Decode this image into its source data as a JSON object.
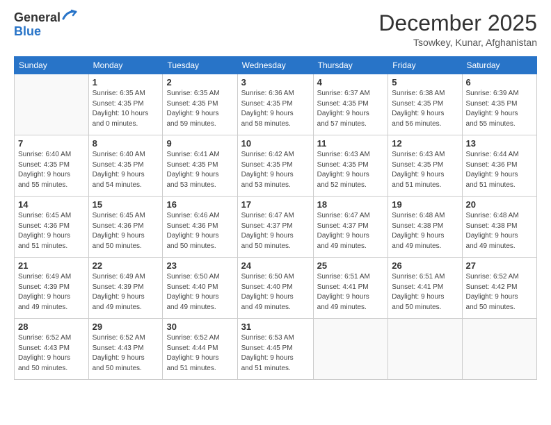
{
  "header": {
    "logo_line1": "General",
    "logo_line2": "Blue",
    "month": "December 2025",
    "location": "Tsowkey, Kunar, Afghanistan"
  },
  "weekdays": [
    "Sunday",
    "Monday",
    "Tuesday",
    "Wednesday",
    "Thursday",
    "Friday",
    "Saturday"
  ],
  "weeks": [
    [
      {
        "day": "",
        "info": ""
      },
      {
        "day": "1",
        "info": "Sunrise: 6:35 AM\nSunset: 4:35 PM\nDaylight: 10 hours\nand 0 minutes."
      },
      {
        "day": "2",
        "info": "Sunrise: 6:35 AM\nSunset: 4:35 PM\nDaylight: 9 hours\nand 59 minutes."
      },
      {
        "day": "3",
        "info": "Sunrise: 6:36 AM\nSunset: 4:35 PM\nDaylight: 9 hours\nand 58 minutes."
      },
      {
        "day": "4",
        "info": "Sunrise: 6:37 AM\nSunset: 4:35 PM\nDaylight: 9 hours\nand 57 minutes."
      },
      {
        "day": "5",
        "info": "Sunrise: 6:38 AM\nSunset: 4:35 PM\nDaylight: 9 hours\nand 56 minutes."
      },
      {
        "day": "6",
        "info": "Sunrise: 6:39 AM\nSunset: 4:35 PM\nDaylight: 9 hours\nand 55 minutes."
      }
    ],
    [
      {
        "day": "7",
        "info": "Sunrise: 6:40 AM\nSunset: 4:35 PM\nDaylight: 9 hours\nand 55 minutes."
      },
      {
        "day": "8",
        "info": "Sunrise: 6:40 AM\nSunset: 4:35 PM\nDaylight: 9 hours\nand 54 minutes."
      },
      {
        "day": "9",
        "info": "Sunrise: 6:41 AM\nSunset: 4:35 PM\nDaylight: 9 hours\nand 53 minutes."
      },
      {
        "day": "10",
        "info": "Sunrise: 6:42 AM\nSunset: 4:35 PM\nDaylight: 9 hours\nand 53 minutes."
      },
      {
        "day": "11",
        "info": "Sunrise: 6:43 AM\nSunset: 4:35 PM\nDaylight: 9 hours\nand 52 minutes."
      },
      {
        "day": "12",
        "info": "Sunrise: 6:43 AM\nSunset: 4:35 PM\nDaylight: 9 hours\nand 51 minutes."
      },
      {
        "day": "13",
        "info": "Sunrise: 6:44 AM\nSunset: 4:36 PM\nDaylight: 9 hours\nand 51 minutes."
      }
    ],
    [
      {
        "day": "14",
        "info": "Sunrise: 6:45 AM\nSunset: 4:36 PM\nDaylight: 9 hours\nand 51 minutes."
      },
      {
        "day": "15",
        "info": "Sunrise: 6:45 AM\nSunset: 4:36 PM\nDaylight: 9 hours\nand 50 minutes."
      },
      {
        "day": "16",
        "info": "Sunrise: 6:46 AM\nSunset: 4:36 PM\nDaylight: 9 hours\nand 50 minutes."
      },
      {
        "day": "17",
        "info": "Sunrise: 6:47 AM\nSunset: 4:37 PM\nDaylight: 9 hours\nand 50 minutes."
      },
      {
        "day": "18",
        "info": "Sunrise: 6:47 AM\nSunset: 4:37 PM\nDaylight: 9 hours\nand 49 minutes."
      },
      {
        "day": "19",
        "info": "Sunrise: 6:48 AM\nSunset: 4:38 PM\nDaylight: 9 hours\nand 49 minutes."
      },
      {
        "day": "20",
        "info": "Sunrise: 6:48 AM\nSunset: 4:38 PM\nDaylight: 9 hours\nand 49 minutes."
      }
    ],
    [
      {
        "day": "21",
        "info": "Sunrise: 6:49 AM\nSunset: 4:39 PM\nDaylight: 9 hours\nand 49 minutes."
      },
      {
        "day": "22",
        "info": "Sunrise: 6:49 AM\nSunset: 4:39 PM\nDaylight: 9 hours\nand 49 minutes."
      },
      {
        "day": "23",
        "info": "Sunrise: 6:50 AM\nSunset: 4:40 PM\nDaylight: 9 hours\nand 49 minutes."
      },
      {
        "day": "24",
        "info": "Sunrise: 6:50 AM\nSunset: 4:40 PM\nDaylight: 9 hours\nand 49 minutes."
      },
      {
        "day": "25",
        "info": "Sunrise: 6:51 AM\nSunset: 4:41 PM\nDaylight: 9 hours\nand 49 minutes."
      },
      {
        "day": "26",
        "info": "Sunrise: 6:51 AM\nSunset: 4:41 PM\nDaylight: 9 hours\nand 50 minutes."
      },
      {
        "day": "27",
        "info": "Sunrise: 6:52 AM\nSunset: 4:42 PM\nDaylight: 9 hours\nand 50 minutes."
      }
    ],
    [
      {
        "day": "28",
        "info": "Sunrise: 6:52 AM\nSunset: 4:43 PM\nDaylight: 9 hours\nand 50 minutes."
      },
      {
        "day": "29",
        "info": "Sunrise: 6:52 AM\nSunset: 4:43 PM\nDaylight: 9 hours\nand 50 minutes."
      },
      {
        "day": "30",
        "info": "Sunrise: 6:52 AM\nSunset: 4:44 PM\nDaylight: 9 hours\nand 51 minutes."
      },
      {
        "day": "31",
        "info": "Sunrise: 6:53 AM\nSunset: 4:45 PM\nDaylight: 9 hours\nand 51 minutes."
      },
      {
        "day": "",
        "info": ""
      },
      {
        "day": "",
        "info": ""
      },
      {
        "day": "",
        "info": ""
      }
    ]
  ]
}
